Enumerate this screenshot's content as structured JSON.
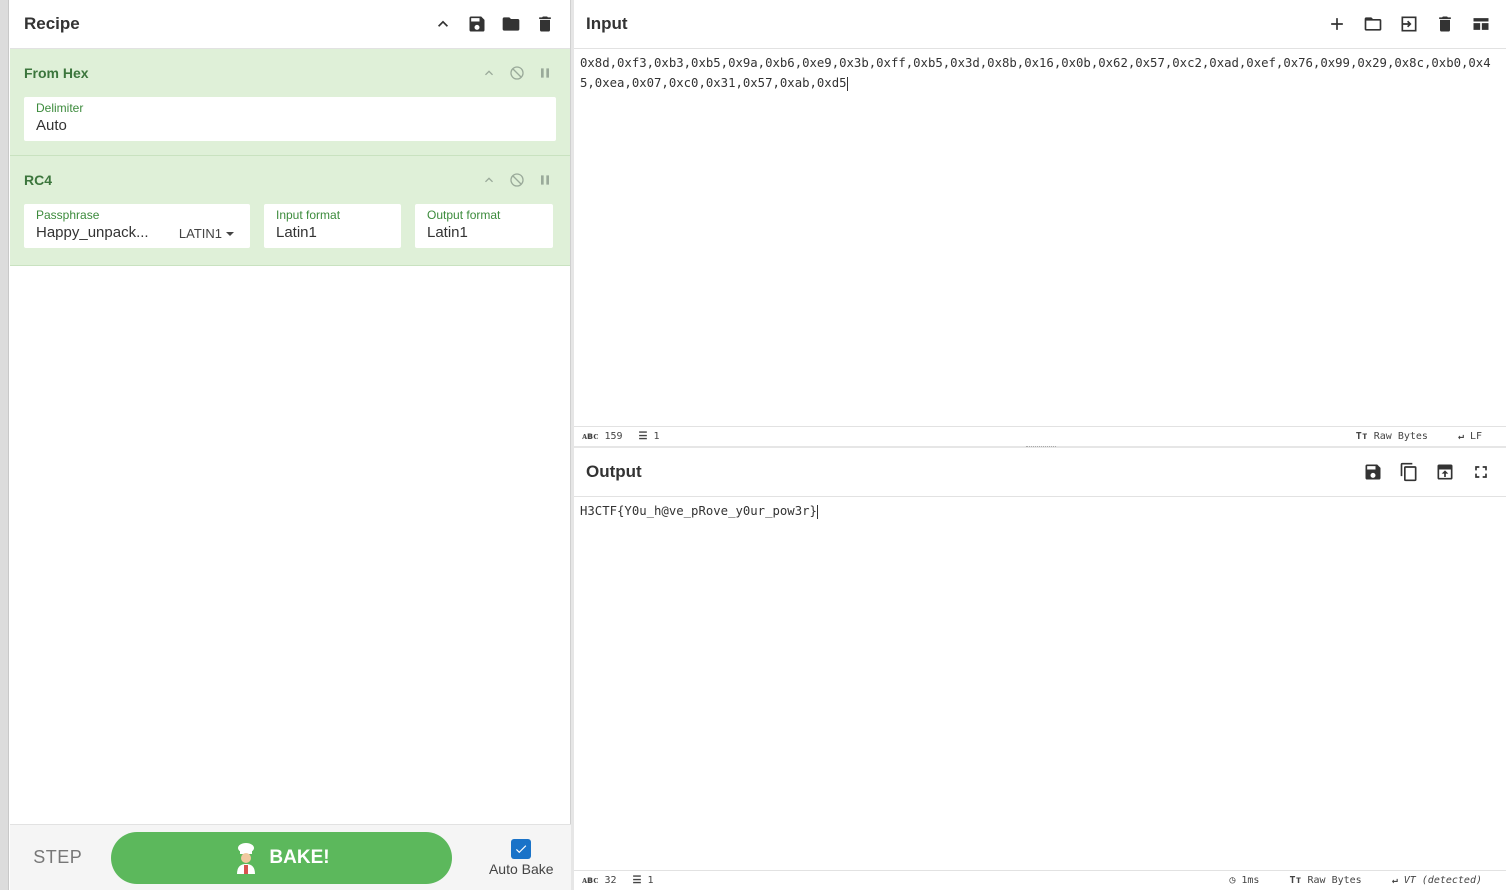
{
  "recipe": {
    "title": "Recipe",
    "operations": [
      {
        "name": "From Hex",
        "fields": [
          {
            "label": "Delimiter",
            "value": "Auto"
          }
        ]
      },
      {
        "name": "RC4",
        "fields": [
          {
            "label": "Passphrase",
            "value": "Happy_unpack...",
            "encoding": "LATIN1"
          },
          {
            "label": "Input format",
            "value": "Latin1"
          },
          {
            "label": "Output format",
            "value": "Latin1"
          }
        ]
      }
    ]
  },
  "controls": {
    "step_label": "STEP",
    "bake_label": "BAKE!",
    "autobake_label": "Auto Bake",
    "autobake_checked": true
  },
  "input": {
    "title": "Input",
    "text": "0x8d,0xf3,0xb3,0xb5,0x9a,0xb6,0xe9,0x3b,0xff,0xb5,0x3d,0x8b,0x16,0x0b,0x62,0x57,0xc2,0xad,0xef,0x76,0x99,0x29,0x8c,0xb0,0x45,0xea,0x07,0xc0,0x31,0x57,0xab,0xd5",
    "status": {
      "chars": "159",
      "lines": "1",
      "encoding": "Raw Bytes",
      "eol": "LF"
    }
  },
  "output": {
    "title": "Output",
    "text": "H3CTF{Y0u_h@ve_pRove_y0ur_pow3r}",
    "status": {
      "chars": "32",
      "lines": "1",
      "time": "1ms",
      "encoding": "Raw Bytes",
      "eol": "VT (detected)"
    }
  },
  "colors": {
    "op_bg": "#dff0d8",
    "op_title": "#3c763d",
    "bake_green": "#5cb85c",
    "checkbox_blue": "#1a73c8"
  }
}
